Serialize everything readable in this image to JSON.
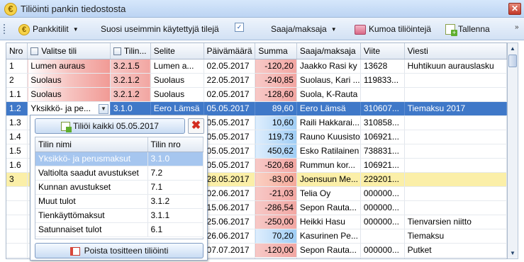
{
  "window": {
    "title": "Tiliöinti pankin tiedostosta",
    "close_label": "✕"
  },
  "toolbar": {
    "bank_accounts_label": "Pankkitilit",
    "favorites_label": "Suosi useimmin käytettyjä tilejä",
    "favorites_checked": true,
    "payee_label": "Saaja/maksaja",
    "undo_label": "Kumoa tiliöintejä",
    "save_label": "Tallenna",
    "more_label": "»"
  },
  "grid": {
    "headers": [
      "Nro",
      "Valitse tili",
      "Tilin...",
      "Selite",
      "Päivämäärä",
      "Summa",
      "Saaja/maksaja",
      "Viite",
      "Viesti"
    ],
    "rows": [
      {
        "nro": "1",
        "account": "Lumen auraus",
        "acc_no": "3.2.1.5",
        "desc": "Lumen a...",
        "date": "02.05.2017",
        "amount": "-120,20",
        "payee": "Jaakko Rasi ky",
        "ref": "13628",
        "msg": "Huhtikuun aurauslasku"
      },
      {
        "nro": "2",
        "account": "Suolaus",
        "acc_no": "3.2.1.2",
        "desc": "Suolaus",
        "date": "22.05.2017",
        "amount": "-240,85",
        "payee": "Suolaus, Kari ...",
        "ref": "119833...",
        "msg": ""
      },
      {
        "nro": "1.1",
        "account": "Suolaus",
        "acc_no": "3.2.1.2",
        "desc": "Suolaus",
        "date": "02.05.2017",
        "amount": "-128,60",
        "payee": "Suola, K-Rauta",
        "ref": "",
        "msg": ""
      },
      {
        "nro": "1.2",
        "account": "Yksikkö- ja pe...",
        "acc_no": "3.1.0",
        "desc": "Eero Lämsä",
        "date": "05.05.2017",
        "amount": "89,60",
        "payee": "Eero Lämsä",
        "ref": "310607...",
        "msg": "Tiemaksu 2017"
      },
      {
        "nro": "1.3",
        "account": "",
        "acc_no": "",
        "desc": "",
        "date": "05.05.2017",
        "amount": "10,60",
        "payee": "Raili Hakkarai...",
        "ref": "310858...",
        "msg": ""
      },
      {
        "nro": "1.4",
        "account": "",
        "acc_no": "",
        "desc": "",
        "date": "05.05.2017",
        "amount": "119,73",
        "payee": "Rauno Kuusisto",
        "ref": "106921...",
        "msg": ""
      },
      {
        "nro": "1.5",
        "account": "",
        "acc_no": "",
        "desc": "",
        "date": "05.05.2017",
        "amount": "450,62",
        "payee": "Esko Ratilainen",
        "ref": "738831...",
        "msg": ""
      },
      {
        "nro": "1.6",
        "account": "",
        "acc_no": "",
        "desc": "",
        "date": "05.05.2017",
        "amount": "-520,68",
        "payee": "Rummun kor...",
        "ref": "106921...",
        "msg": ""
      },
      {
        "nro": "3",
        "account": "",
        "acc_no": "",
        "desc": "",
        "date": "28.05.2017",
        "amount": "-83,00",
        "payee": "Joensuun Me...",
        "ref": "229201...",
        "msg": ""
      },
      {
        "nro": "",
        "account": "",
        "acc_no": "",
        "desc": "",
        "date": "02.06.2017",
        "amount": "-21,03",
        "payee": "Telia Oy",
        "ref": "000000...",
        "msg": ""
      },
      {
        "nro": "",
        "account": "",
        "acc_no": "",
        "desc": "",
        "date": "15.06.2017",
        "amount": "-286,54",
        "payee": "Sepon Rauta...",
        "ref": "000000...",
        "msg": ""
      },
      {
        "nro": "",
        "account": "",
        "acc_no": "",
        "desc": "",
        "date": "25.06.2017",
        "amount": "-250,00",
        "payee": "Heikki Hasu",
        "ref": "000000...",
        "msg": "Tienvarsien niitto"
      },
      {
        "nro": "",
        "account": "",
        "acc_no": "",
        "desc": "",
        "date": "26.06.2017",
        "amount": "70,20",
        "payee": "Kasurinen Pe...",
        "ref": "",
        "msg": "Tiemaksu"
      },
      {
        "nro": "",
        "account": "",
        "acc_no": "",
        "desc": "",
        "date": "07.07.2017",
        "amount": "-120,00",
        "payee": "Sepon Rauta...",
        "ref": "000000...",
        "msg": "Putket"
      },
      {
        "nro": "",
        "account": "",
        "acc_no": "",
        "desc": "",
        "date": "",
        "amount": "",
        "payee": "",
        "ref": "",
        "msg": ""
      }
    ]
  },
  "popup": {
    "assign_all_label": "Tiliöi kaikki 05.05.2017",
    "col_account_name": "Tilin nimi",
    "col_account_no": "Tilin nro",
    "accounts": [
      {
        "name": "Yksikkö- ja perusmaksut",
        "no": "3.1.0"
      },
      {
        "name": "Valtiolta saadut avustukset",
        "no": "7.2"
      },
      {
        "name": "Kunnan avustukset",
        "no": "7.1"
      },
      {
        "name": "Muut tulot",
        "no": "3.1.2"
      },
      {
        "name": "Tienkäyttömaksut",
        "no": "3.1.1"
      },
      {
        "name": "Satunnaiset tulot",
        "no": "6.1"
      }
    ],
    "remove_label": "Poista tositteen tiliöinti"
  },
  "colors": {
    "selection": "#3f78c8",
    "negative": "#f2a6a2",
    "positive": "#9fcdf5",
    "highlight_row": "#fbefa8"
  }
}
